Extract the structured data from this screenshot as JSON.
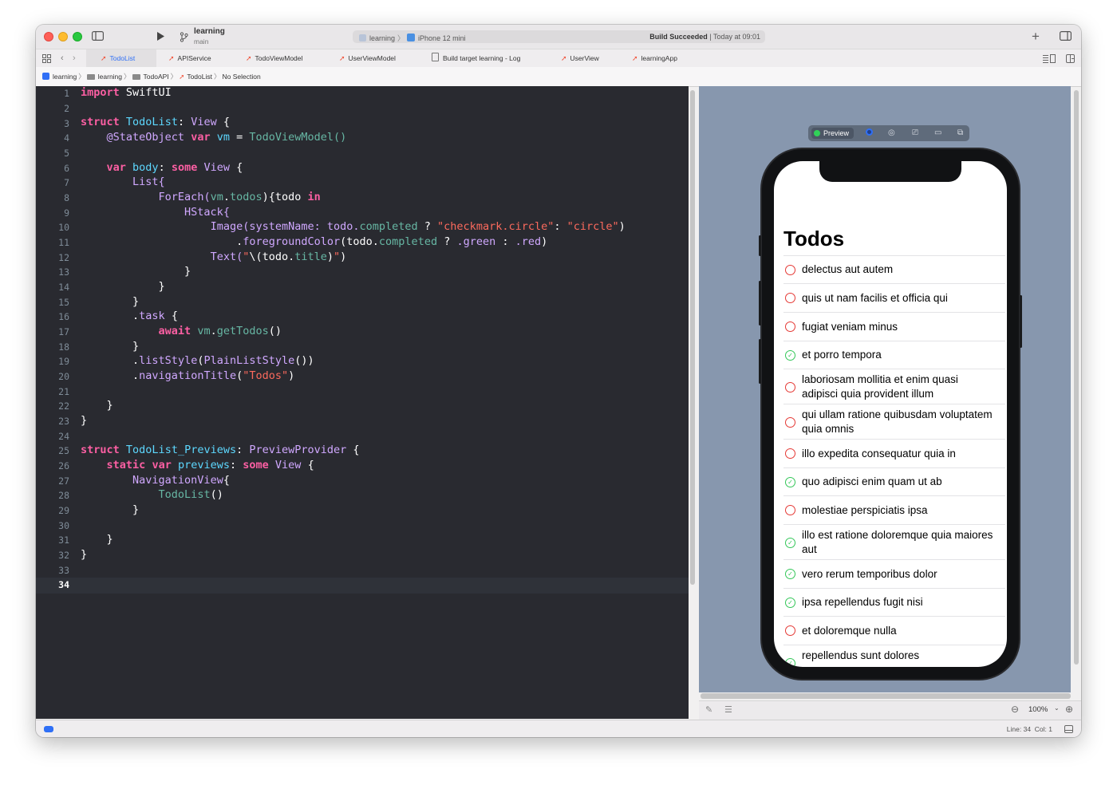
{
  "titlebar": {
    "scheme_name": "learning",
    "scheme_branch": "main",
    "run_target": "learning",
    "device": "iPhone 12 mini",
    "build_status_bold": "Build Succeeded",
    "build_status_time": "| Today at 09:01",
    "add_icon": "+"
  },
  "tabs": [
    {
      "label": "TodoList",
      "icon": "swift-file-icon",
      "active": true
    },
    {
      "label": "APIService",
      "icon": "swift-file-icon"
    },
    {
      "label": "TodoViewModel",
      "icon": "swift-file-icon"
    },
    {
      "label": "UserViewModel",
      "icon": "swift-file-icon"
    },
    {
      "label": "Build target learning - Log",
      "icon": "document-icon"
    },
    {
      "label": "UserView",
      "icon": "swift-file-icon"
    },
    {
      "label": "learningApp",
      "icon": "swift-file-icon"
    }
  ],
  "jumpbar": [
    "learning",
    "learning",
    "TodoAPI",
    "TodoList",
    "No Selection"
  ],
  "line_numbers": [
    "1",
    "2",
    "3",
    "4",
    "5",
    "6",
    "7",
    "8",
    "9",
    "10",
    "11",
    "12",
    "13",
    "14",
    "15",
    "16",
    "17",
    "18",
    "19",
    "20",
    "21",
    "22",
    "23",
    "24",
    "25",
    "26",
    "27",
    "28",
    "29",
    "30",
    "31",
    "32",
    "33",
    "34"
  ],
  "current_line": "34",
  "code": {
    "l1_kw": "import",
    "l1_rest": " SwiftUI",
    "l3_kw": "struct",
    "l3_name": "TodoList",
    "l3_colon": ": ",
    "l3_type": "View",
    "l3_end": " {",
    "l4_attr": "@StateObject",
    "l4_kw": "var",
    "l4_var": "vm",
    "l4_eq": " = ",
    "l4_call": "TodoViewModel()",
    "l6_kw": "var",
    "l6_prop": "body",
    "l6_colon": ": ",
    "l6_kw2": "some",
    "l6_type": "View",
    "l6_end": " {",
    "l7": "List{",
    "l8_a": "ForEach(",
    "l8_vm": "vm",
    "l8_dot": ".",
    "l8_todos": "todos",
    "l8_b": "){todo ",
    "l8_in": "in",
    "l9": "HStack{",
    "l10_a": "Image(systemName: todo.",
    "l10_completed": "completed",
    "l10_q": " ? ",
    "l10_s1": "\"checkmark.circle\"",
    "l10_colon": ": ",
    "l10_s2": "\"circle\"",
    "l10_end": ")",
    "l11_dot": ".",
    "l11_fn": "foregroundColor",
    "l11_a": "(todo.",
    "l11_completed": "completed",
    "l11_q": " ? ",
    "l11_green": ".green",
    "l11_c": " : ",
    "l11_red": ".red",
    "l11_end": ")",
    "l12_a": "Text(",
    "l12_s1": "\"",
    "l12_b": "\\(todo.",
    "l12_title": "title",
    "l12_c": ")",
    "l12_s2": "\"",
    "l12_end": ")",
    "l13": "}",
    "l14": "}",
    "l15": "}",
    "l16_dot": ".",
    "l16_fn": "task",
    "l16_end": " {",
    "l17_kw": "await",
    "l17_vm": "vm",
    "l17_dot": ".",
    "l17_fn": "getTodos",
    "l17_end": "()",
    "l18": "}",
    "l19_dot": ".",
    "l19_fn": "listStyle",
    "l19_a": "(",
    "l19_type": "PlainListStyle",
    "l19_end": "())",
    "l20_dot": ".",
    "l20_fn": "navigationTitle",
    "l20_a": "(",
    "l20_s": "\"Todos\"",
    "l20_end": ")",
    "l22": "}",
    "l23": "}",
    "l25_kw": "struct",
    "l25_name": "TodoList_Previews",
    "l25_colon": ": ",
    "l25_type": "PreviewProvider",
    "l25_end": " {",
    "l26_kw": "static",
    "l26_kw2": "var",
    "l26_prop": "previews",
    "l26_colon": ": ",
    "l26_kw3": "some",
    "l26_type": "View",
    "l26_end": " {",
    "l27_type": "NavigationView",
    "l27_end": "{",
    "l28_call": "TodoList",
    "l28_end": "()",
    "l29": "}",
    "l31": "}",
    "l32": "}"
  },
  "preview": {
    "label": "Preview",
    "nav_title": "Todos",
    "todos": [
      {
        "title": "delectus aut autem",
        "completed": false
      },
      {
        "title": "quis ut nam facilis et officia qui",
        "completed": false
      },
      {
        "title": "fugiat veniam minus",
        "completed": false
      },
      {
        "title": "et porro tempora",
        "completed": true
      },
      {
        "title": "laboriosam mollitia et enim quasi adipisci quia provident illum",
        "completed": false
      },
      {
        "title": "qui ullam ratione quibusdam voluptatem quia omnis",
        "completed": false
      },
      {
        "title": "illo expedita consequatur quia in",
        "completed": false
      },
      {
        "title": "quo adipisci enim quam ut ab",
        "completed": true
      },
      {
        "title": "molestiae perspiciatis ipsa",
        "completed": false
      },
      {
        "title": "illo est ratione doloremque quia maiores aut",
        "completed": true
      },
      {
        "title": "vero rerum temporibus dolor",
        "completed": true
      },
      {
        "title": "ipsa repellendus fugit nisi",
        "completed": true
      },
      {
        "title": "et doloremque nulla",
        "completed": false
      },
      {
        "title": "repellendus sunt dolores",
        "completed": true
      }
    ]
  },
  "canvas": {
    "zoom": "100%"
  },
  "statusbar": {
    "line": "Line: 34",
    "col": "Col: 1"
  },
  "colors": {
    "editor_bg": "#292a30",
    "keyword": "#fc5fa3",
    "type": "#5dd8ff",
    "property": "#d0a8ff",
    "name": "#67b7a4",
    "string": "#fc6a5d",
    "accent": "#2f6ff6",
    "canvas_bg": "#8797ae",
    "circle_red": "#e53935",
    "check_green": "#34c759"
  }
}
